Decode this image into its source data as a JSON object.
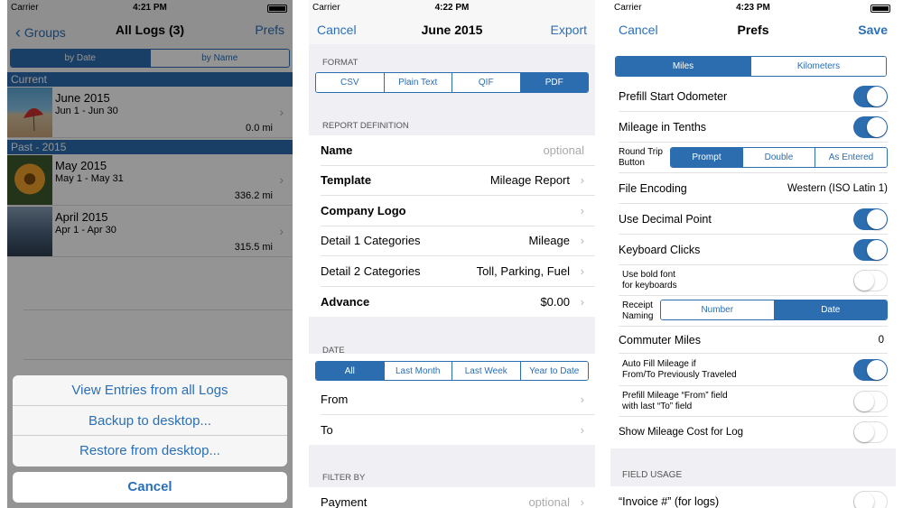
{
  "screen1": {
    "status": {
      "carrier": "Carrier",
      "time": "4:21 PM"
    },
    "nav": {
      "back": "Groups",
      "title": "All Logs (3)",
      "right": "Prefs"
    },
    "segment": [
      "by Date",
      "by Name"
    ],
    "sections": [
      {
        "title": "Current",
        "rows": [
          {
            "name": "June 2015",
            "dates": "Jun 1 - Jun 30",
            "miles": "0.0 mi"
          }
        ]
      },
      {
        "title": "Past - 2015",
        "rows": [
          {
            "name": "May 2015",
            "dates": "May 1 - May 31",
            "miles": "336.2 mi"
          },
          {
            "name": "April 2015",
            "dates": "Apr 1 - Apr 30",
            "miles": "315.5 mi"
          }
        ]
      }
    ],
    "action_sheet": [
      "View Entries from all Logs",
      "Backup to desktop...",
      "Restore from desktop..."
    ],
    "cancel": "Cancel"
  },
  "screen2": {
    "status": {
      "carrier": "Carrier",
      "time": "4:22 PM"
    },
    "nav": {
      "left": "Cancel",
      "title": "June 2015",
      "right": "Export"
    },
    "format_header": "FORMAT",
    "format_options": [
      "CSV",
      "Plain Text",
      "QIF",
      "PDF"
    ],
    "format_selected": "PDF",
    "report_header": "REPORT DEFINITION",
    "report_rows": [
      {
        "label": "Name",
        "value": "optional"
      },
      {
        "label": "Template",
        "value": "Mileage Report"
      },
      {
        "label": "Company Logo",
        "value": ""
      },
      {
        "label": "Detail 1 Categories",
        "value": "Mileage"
      },
      {
        "label": "Detail 2 Categories",
        "value": "Toll, Parking, Fuel"
      },
      {
        "label": "Advance",
        "value": "$0.00"
      }
    ],
    "date_header": "DATE",
    "date_options": [
      "All",
      "Last Month",
      "Last Week",
      "Year to Date"
    ],
    "date_selected": "All",
    "date_rows": [
      {
        "label": "From"
      },
      {
        "label": "To"
      }
    ],
    "filter_header": "FILTER BY",
    "filter_rows": [
      {
        "label": "Payment",
        "value": "optional"
      }
    ]
  },
  "screen3": {
    "status": {
      "carrier": "Carrier",
      "time": "4:23 PM"
    },
    "nav": {
      "left": "Cancel",
      "title": "Prefs",
      "right": "Save"
    },
    "units": [
      "Miles",
      "Kilometers"
    ],
    "units_selected": "Miles",
    "prefill_start_odometer": {
      "label": "Prefill Start Odometer",
      "on": true
    },
    "mileage_in_tenths": {
      "label": "Mileage in Tenths",
      "on": true
    },
    "round_trip": {
      "label_line1": "Round Trip",
      "label_line2": "Button",
      "options": [
        "Prompt",
        "Double",
        "As Entered"
      ],
      "selected": "Prompt"
    },
    "file_encoding": {
      "label": "File Encoding",
      "value": "Western (ISO Latin 1)"
    },
    "use_decimal_point": {
      "label": "Use Decimal Point",
      "on": true
    },
    "keyboard_clicks": {
      "label": "Keyboard Clicks",
      "on": true
    },
    "bold_font": {
      "label_line1": "Use bold font",
      "label_line2": "for keyboards",
      "on": false
    },
    "receipt_naming": {
      "label_line1": "Receipt",
      "label_line2": "Naming",
      "options": [
        "Number",
        "Date"
      ],
      "selected": "Date"
    },
    "commuter_miles": {
      "label": "Commuter Miles",
      "value": "0"
    },
    "auto_fill": {
      "label_line1": "Auto Fill Mileage if",
      "label_line2": "From/To Previously Traveled",
      "on": true
    },
    "prefill_from": {
      "label_line1": "Prefill Mileage “From” field",
      "label_line2": "with last “To” field",
      "on": false
    },
    "show_cost": {
      "label": "Show Mileage Cost for Log",
      "on": false
    },
    "field_usage_header": "FIELD USAGE",
    "invoice": {
      "label": "“Invoice #” (for logs)",
      "on": false
    }
  }
}
